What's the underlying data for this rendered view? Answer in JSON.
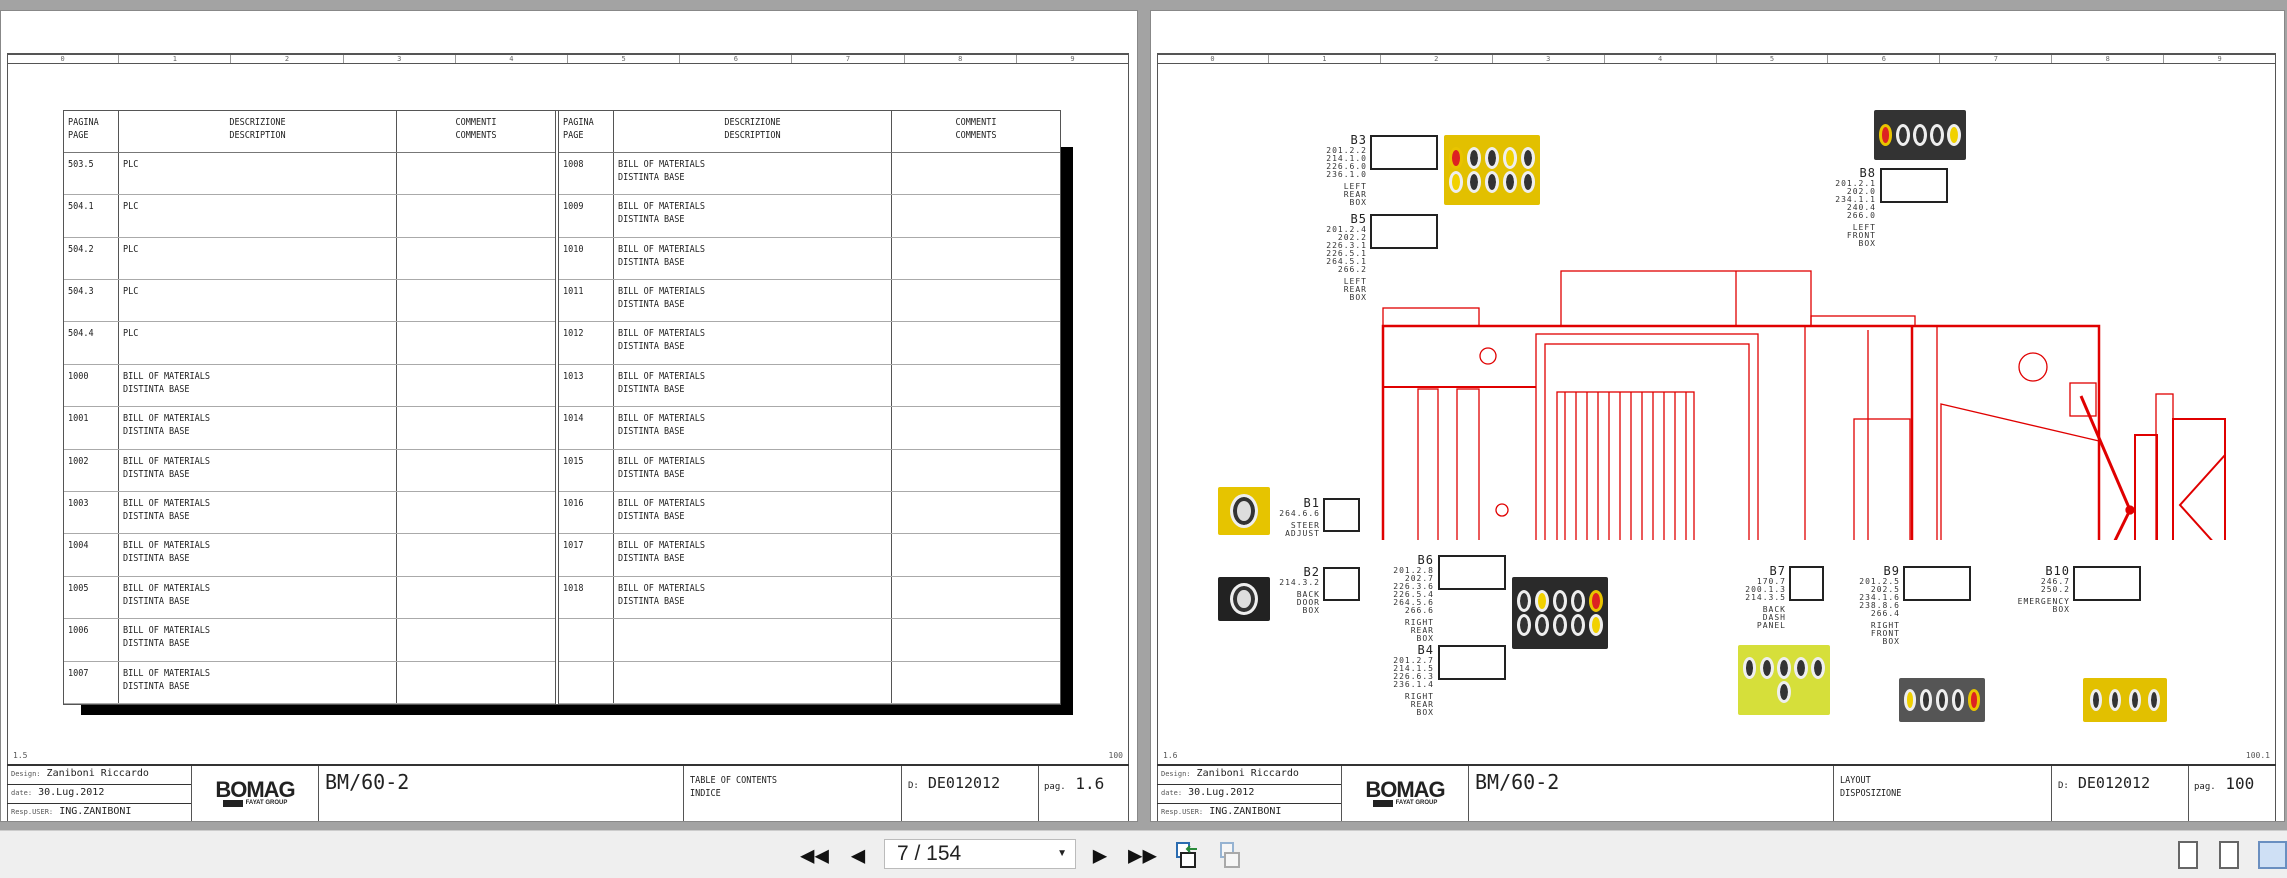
{
  "ruler": [
    "0",
    "1",
    "2",
    "3",
    "4",
    "5",
    "6",
    "7",
    "8",
    "9"
  ],
  "left_page": {
    "headers": {
      "page": "PAGINA\nPAGE",
      "desc": "DESCRIZIONE\nDESCRIPTION",
      "comm": "COMMENTI\nCOMMENTS"
    },
    "col_a": [
      [
        "503.5",
        "PLC"
      ],
      [
        "504.1",
        "PLC"
      ],
      [
        "504.2",
        "PLC"
      ],
      [
        "504.3",
        "PLC"
      ],
      [
        "504.4",
        "PLC"
      ],
      [
        "1000",
        "BILL OF MATERIALS\nDISTINTA BASE"
      ],
      [
        "1001",
        "BILL OF MATERIALS\nDISTINTA BASE"
      ],
      [
        "1002",
        "BILL OF MATERIALS\nDISTINTA BASE"
      ],
      [
        "1003",
        "BILL OF MATERIALS\nDISTINTA BASE"
      ],
      [
        "1004",
        "BILL OF MATERIALS\nDISTINTA BASE"
      ],
      [
        "1005",
        "BILL OF MATERIALS\nDISTINTA BASE"
      ],
      [
        "1006",
        "BILL OF MATERIALS\nDISTINTA BASE"
      ],
      [
        "1007",
        "BILL OF MATERIALS\nDISTINTA BASE"
      ]
    ],
    "col_b": [
      [
        "1008",
        "BILL OF MATERIALS\nDISTINTA BASE"
      ],
      [
        "1009",
        "BILL OF MATERIALS\nDISTINTA BASE"
      ],
      [
        "1010",
        "BILL OF MATERIALS\nDISTINTA BASE"
      ],
      [
        "1011",
        "BILL OF MATERIALS\nDISTINTA BASE"
      ],
      [
        "1012",
        "BILL OF MATERIALS\nDISTINTA BASE"
      ],
      [
        "1013",
        "BILL OF MATERIALS\nDISTINTA BASE"
      ],
      [
        "1014",
        "BILL OF MATERIALS\nDISTINTA BASE"
      ],
      [
        "1015",
        "BILL OF MATERIALS\nDISTINTA BASE"
      ],
      [
        "1016",
        "BILL OF MATERIALS\nDISTINTA BASE"
      ],
      [
        "1017",
        "BILL OF MATERIALS\nDISTINTA BASE"
      ],
      [
        "1018",
        "BILL OF MATERIALS\nDISTINTA BASE"
      ],
      [
        "",
        ""
      ],
      [
        "",
        ""
      ]
    ],
    "prev": "1.5",
    "next": "100",
    "title_block": {
      "design_label": "Design:",
      "design": "Zaniboni Riccardo",
      "date_label": "date:",
      "date": "30.Lug.2012",
      "resp_label": "Resp.USER:",
      "resp": "ING.ZANIBONI",
      "logo": "BOMAG",
      "logo_sub": "FAYAT GROUP",
      "model": "BM/60-2",
      "desc": "TABLE OF CONTENTS\nINDICE",
      "doc_label": "D:",
      "doc": "DE012012",
      "pag_label": "pag.",
      "pag": "1.6"
    }
  },
  "right_page": {
    "prev": "1.6",
    "next": "100.1",
    "boxes": [
      {
        "id": "B3",
        "refs": "201.2.2\n214.1.0\n226.6.0\n236.1.0",
        "where": "LEFT\nREAR\nBOX"
      },
      {
        "id": "B5",
        "refs": "201.2.4\n202.2\n226.3.1\n226.5.1\n264.5.1\n266.2",
        "where": "LEFT\nREAR\nBOX"
      },
      {
        "id": "B8",
        "refs": "201.2.1\n202.0\n234.1.1\n240.4\n266.0",
        "where": "LEFT\nFRONT\nBOX"
      },
      {
        "id": "B1",
        "refs": "264.6.6",
        "where": "STEER\nADJUST"
      },
      {
        "id": "B2",
        "refs": "214.3.2",
        "where": "BACK\nDOOR\nBOX"
      },
      {
        "id": "B6",
        "refs": "201.2.8\n202.7\n226.3.6\n226.5.4\n264.5.6\n266.6",
        "where": "RIGHT\nREAR\nBOX"
      },
      {
        "id": "B4",
        "refs": "201.2.7\n214.1.5\n226.6.3\n236.1.4",
        "where": "RIGHT\nREAR\nBOX"
      },
      {
        "id": "B7",
        "refs": "170.7\n200.1.3\n214.3.5",
        "where": "BACK\nDASH\nPANEL"
      },
      {
        "id": "B9",
        "refs": "201.2.5\n202.5\n234.1.6\n238.8.6\n266.4",
        "where": "RIGHT\nFRONT\nBOX"
      },
      {
        "id": "B10",
        "refs": "246.7\n250.2",
        "where": "EMERGENCY\nBOX"
      }
    ],
    "title_block": {
      "design_label": "Design:",
      "design": "Zaniboni Riccardo",
      "date_label": "date:",
      "date": "30.Lug.2012",
      "resp_label": "Resp.USER:",
      "resp": "ING.ZANIBONI",
      "logo": "BOMAG",
      "logo_sub": "FAYAT GROUP",
      "model": "BM/60-2",
      "desc": "LAYOUT\nDISPOSIZIONE",
      "doc_label": "D:",
      "doc": "DE012012",
      "pag_label": "pag.",
      "pag": "100"
    }
  },
  "toolbar": {
    "page_indicator": "7 / 154",
    "first": "first-page",
    "prev": "previous-page",
    "next": "next-page",
    "last": "last-page"
  },
  "colors": {
    "drawing": "#e00000",
    "panel_yellow": "#e9c400"
  }
}
